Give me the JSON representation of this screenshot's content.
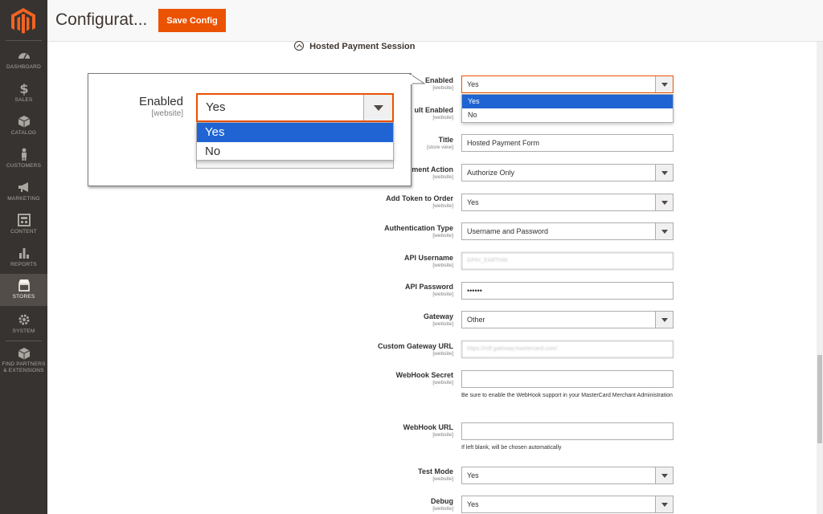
{
  "sidebar": {
    "items": [
      {
        "label": "DASHBOARD",
        "icon": "dashboard-icon"
      },
      {
        "label": "SALES",
        "icon": "dollar-icon"
      },
      {
        "label": "CATALOG",
        "icon": "box-icon"
      },
      {
        "label": "CUSTOMERS",
        "icon": "person-icon"
      },
      {
        "label": "MARKETING",
        "icon": "megaphone-icon"
      },
      {
        "label": "CONTENT",
        "icon": "layout-icon"
      },
      {
        "label": "REPORTS",
        "icon": "bar-chart-icon"
      },
      {
        "label": "STORES",
        "icon": "store-icon"
      },
      {
        "label": "SYSTEM",
        "icon": "gear-icon"
      },
      {
        "label_line1": "FIND PARTNERS",
        "label_line2": "& EXTENSIONS",
        "icon": "cube-icon"
      }
    ]
  },
  "header": {
    "title": "Configurat...",
    "save_label": "Save Config"
  },
  "section": {
    "title": "Hosted Payment Session"
  },
  "zoom": {
    "label": "Enabled",
    "scope": "[website]",
    "value": "Yes",
    "options": [
      "Yes",
      "No"
    ]
  },
  "form": {
    "enabled": {
      "label": "Enabled",
      "scope": "[website]",
      "value": "Yes",
      "options": [
        "Yes",
        "No"
      ]
    },
    "vault": {
      "label": "ult Enabled",
      "scope": "[website]"
    },
    "title": {
      "label": "Title",
      "scope": "[store view]",
      "value": "Hosted Payment Form"
    },
    "payment_action": {
      "label": "ment Action",
      "scope": "[website]",
      "value": "Authorize Only"
    },
    "add_token": {
      "label": "Add Token to Order",
      "scope": "[website]",
      "value": "Yes"
    },
    "auth_type": {
      "label": "Authentication Type",
      "scope": "[website]",
      "value": "Username and Password"
    },
    "api_username": {
      "label": "API Username",
      "scope": "[website]",
      "value": "GPIH_EARTHIK"
    },
    "api_password": {
      "label": "API Password",
      "scope": "[website]",
      "value": "••••••"
    },
    "gateway": {
      "label": "Gateway",
      "scope": "[website]",
      "value": "Other"
    },
    "custom_url": {
      "label": "Custom Gateway URL",
      "scope": "[website]",
      "value": "https://mtf.gateway.mastercard.com/"
    },
    "webhook_secret": {
      "label": "WebHook Secret",
      "scope": "[website]",
      "value": "",
      "note": "Be sure to enable the WebHook support in your MasterCard Merchant Administration"
    },
    "webhook_url": {
      "label": "WebHook URL",
      "scope": "[website]",
      "value": "",
      "note": "If left blank, will be chosen automatically"
    },
    "test_mode": {
      "label": "Test Mode",
      "scope": "[website]",
      "value": "Yes"
    },
    "debug": {
      "label": "Debug",
      "scope": "[website]",
      "value": "Yes"
    }
  },
  "colors": {
    "accent": "#eb5202",
    "sidebar_bg": "#373330",
    "selection": "#1f64d2"
  }
}
